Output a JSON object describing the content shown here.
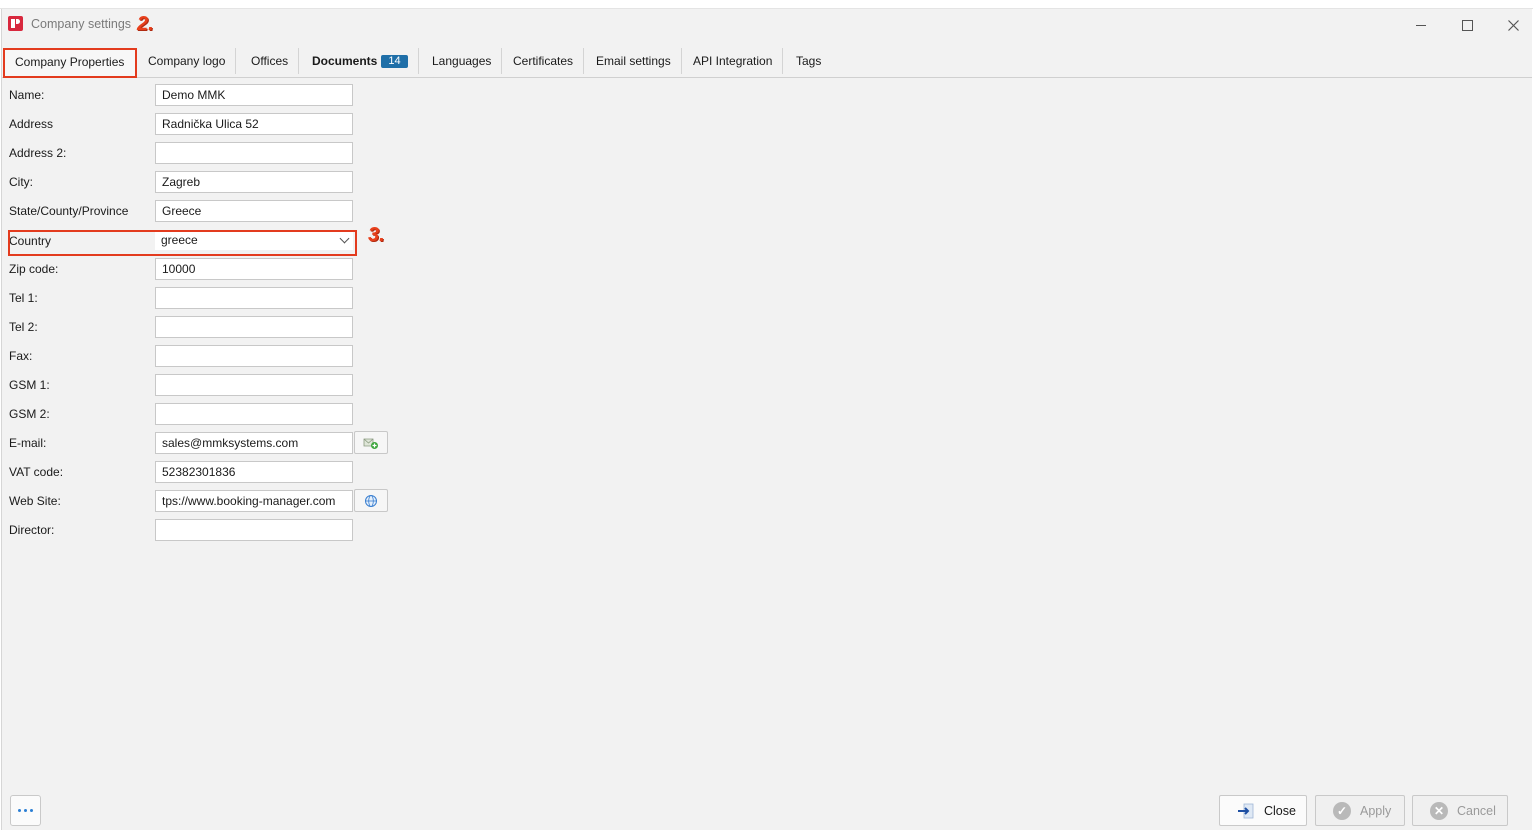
{
  "window": {
    "title": "Company settings",
    "annotation_title": "2.",
    "annotation_country": "3."
  },
  "tabs": [
    {
      "label": "Company Properties"
    },
    {
      "label": "Company logo"
    },
    {
      "label": "Offices"
    },
    {
      "label": "Documents",
      "badge": "14"
    },
    {
      "label": "Languages"
    },
    {
      "label": "Certificates"
    },
    {
      "label": "Email settings"
    },
    {
      "label": "API Integration"
    },
    {
      "label": "Tags"
    }
  ],
  "form": {
    "name": {
      "label": "Name:",
      "value": "Demo MMK"
    },
    "address": {
      "label": "Address",
      "value": "Radnička Ulica 52"
    },
    "address2": {
      "label": "Address 2:",
      "value": ""
    },
    "city": {
      "label": "City:",
      "value": "Zagreb"
    },
    "state": {
      "label": "State/County/Province",
      "value": "Greece"
    },
    "country": {
      "label": "Country",
      "value": "greece"
    },
    "zip": {
      "label": "Zip code:",
      "value": "10000"
    },
    "tel1": {
      "label": "Tel 1:",
      "value": ""
    },
    "tel2": {
      "label": "Tel 2:",
      "value": ""
    },
    "fax": {
      "label": "Fax:",
      "value": ""
    },
    "gsm1": {
      "label": "GSM 1:",
      "value": ""
    },
    "gsm2": {
      "label": "GSM 2:",
      "value": ""
    },
    "email": {
      "label": "E-mail:",
      "value": "sales@mmksystems.com"
    },
    "vat": {
      "label": "VAT code:",
      "value": "52382301836"
    },
    "website": {
      "label": "Web Site:",
      "value": "tps://www.booking-manager.com"
    },
    "director": {
      "label": "Director:",
      "value": ""
    }
  },
  "footer": {
    "close_label": "Close",
    "apply_label": "Apply",
    "cancel_label": "Cancel"
  },
  "colors": {
    "accent_red": "#e33b1e",
    "badge_blue": "#1f6fa8",
    "brand_red": "#d8283e"
  }
}
